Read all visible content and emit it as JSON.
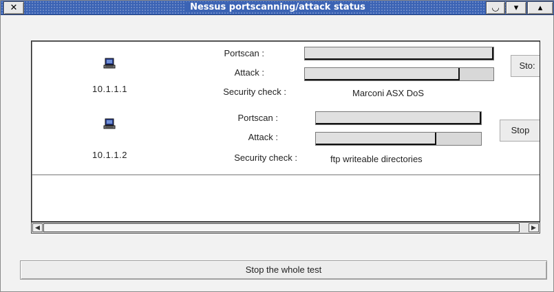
{
  "window": {
    "title": "Nessus portscanning/attack status",
    "close_glyph": "✕",
    "shade_glyph": "◡",
    "minimize_glyph": "▾",
    "maximize_glyph": "▴"
  },
  "hosts": [
    {
      "ip": "10.1.1.1",
      "icon": "computer-icon",
      "portscan_label": "Portscan :",
      "portscan_progress": 1.0,
      "attack_label": "Attack :",
      "attack_progress": 0.82,
      "security_check_label": "Security check :",
      "security_check_value": "Marconi ASX DoS",
      "stop_label": "Sto:"
    },
    {
      "ip": "10.1.1.2",
      "icon": "computer-icon",
      "portscan_label": "Portscan :",
      "portscan_progress": 1.0,
      "attack_label": "Attack :",
      "attack_progress": 0.73,
      "security_check_label": "Security check :",
      "security_check_value": "ftp writeable directories",
      "stop_label": "Stop"
    }
  ],
  "scrollbar": {
    "left_arrow": "◀",
    "right_arrow": "▶"
  },
  "stop_all_label": "Stop the whole test",
  "colors": {
    "titlebar": "#3b63b4",
    "window_bg": "#f2f2f2",
    "panel_bg": "#ffffff",
    "progress_track": "#d8d8d8"
  }
}
